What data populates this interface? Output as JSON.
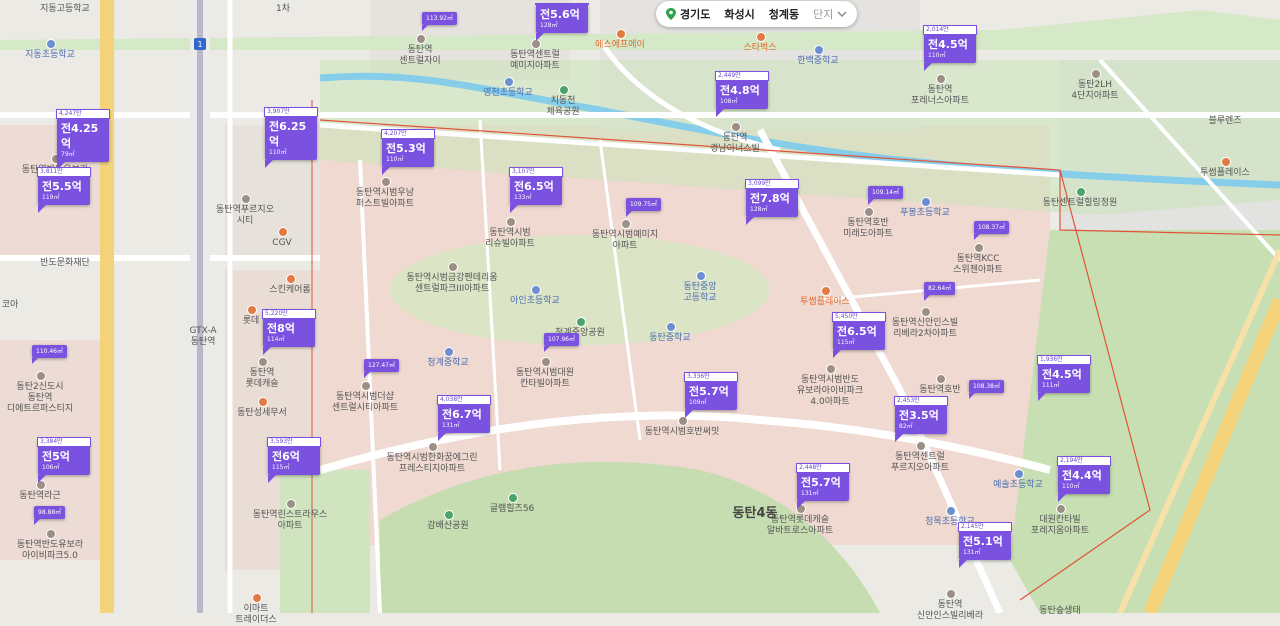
{
  "breadcrumb": {
    "province": "경기도",
    "city": "화성시",
    "dong": "청계동",
    "level": "단지",
    "icons": {
      "location": "location-pin-icon",
      "expand": "chevron-down-icon"
    }
  },
  "markers": [
    {
      "top": "",
      "price": "전5.6억",
      "area": "128㎡"
    },
    {
      "top": "2,014만",
      "price": "전4.5억",
      "area": "110㎡"
    },
    {
      "top": "2,449만",
      "price": "전4.8억",
      "area": "108㎡"
    },
    {
      "top": "4,247만",
      "price": "전4.25억",
      "area": "79㎡"
    },
    {
      "top": "3,907만",
      "price": "전6.25억",
      "area": "110㎡"
    },
    {
      "top": "4,207만",
      "price": "전5.3억",
      "area": "110㎡"
    },
    {
      "top": "3,811만",
      "price": "전5.5억",
      "area": "119㎡"
    },
    {
      "top": "3,107만",
      "price": "전6.5억",
      "area": "133㎡"
    },
    {
      "top": "3,099만",
      "price": "전7.8억",
      "area": "128㎡"
    },
    {
      "top": "5,220만",
      "price": "전8억",
      "area": "114㎡"
    },
    {
      "top": "5,450만",
      "price": "전6.5억",
      "area": "115㎡"
    },
    {
      "top": "1,936만",
      "price": "전4.5억",
      "area": "111㎡"
    },
    {
      "top": "3,336만",
      "price": "전5.7억",
      "area": "109㎡"
    },
    {
      "top": "4,038만",
      "price": "전6.7억",
      "area": "131㎡"
    },
    {
      "top": "2,453만",
      "price": "전3.5억",
      "area": "82㎡"
    },
    {
      "top": "3,384만",
      "price": "전5억",
      "area": "106㎡"
    },
    {
      "top": "3,593만",
      "price": "전6억",
      "area": "115㎡"
    },
    {
      "top": "2,448만",
      "price": "전5.7억",
      "area": "131㎡"
    },
    {
      "top": "2,194만",
      "price": "전4.4억",
      "area": "110㎡"
    },
    {
      "top": "2,145만",
      "price": "전5.1억",
      "area": "131㎡"
    }
  ],
  "area_badges": [
    "113.92㎡",
    "109.14㎡",
    "109.75㎡",
    "108.37㎡",
    "82.64㎡",
    "107.96㎡",
    "127.47㎡",
    "110.46㎡",
    "108.38㎡",
    "98.88㎡"
  ],
  "places": {
    "complexes": [
      "동탄역\n센트럴자이",
      "동탄역센트럴\n예미지아파트",
      "동탄역\n경남아너스빌",
      "동탄2LH\n4단지아파트",
      "동탄역\n포레너스아파트",
      "동탄역반도유보라\n아이비",
      "동탄역시범우남\n퍼스트빌아파트",
      "동탄역시범\n리슈빌아파트",
      "동탄역시범예미지\n아파트",
      "동탄역호반\n미래도아파트",
      "동탄역KCC\n스위첸아파트",
      "동탄역시범금강펜테리움\n센트럴파크III아파트",
      "동탄역신안인스빌\n리베라2차아파트",
      "동탄역시범반도\n유보라아이비파크\n4.0아파트",
      "동탄역시범대원\n칸타빌아파트",
      "동탄역시범더샵\n센트럴시티아파트",
      "동탄역시범한화꿈에그린\n프레스티지아파트",
      "동탄역시범호반써밋",
      "동탄역센트럴\n푸르지오아파트",
      "동탄역롯데캐슬\n알바트로스아파트",
      "대원칸타빌\n포레지움아파트",
      "동탄역\n신안인스빌리베라",
      "동탄역푸르지오\n시티",
      "동탄역\n롯데캐슬",
      "동탄역린스트라우스\n아파트",
      "동탄2신도시\n동탄역\n디에트르퍼스티지",
      "동탄역라근",
      "동탄역반도유보라\n아이비파크5.0",
      "동탄역호반"
    ],
    "schools": [
      "지동초등학교",
      "영천초등학교",
      "한백중학교",
      "푸봉초등학교",
      "아인초등학교",
      "동탄중학교",
      "동탄중앙\n고등학교",
      "청계중학교",
      "예솔초등학교",
      "청목초등학교"
    ],
    "parks": [
      "치동천\n체육공원",
      "청계중앙공원",
      "동탄센트럴힐링정원",
      "감배산공원",
      "글램힐즈56"
    ],
    "shops": [
      "스타벅스",
      "에스에프에이",
      "투썸플레이스",
      "투썸플레이스",
      "CGV",
      "스킨케어롬",
      "롯데",
      "동탄성세무서",
      "이마트\n트레이더스"
    ],
    "misc": [
      "지동고등학교",
      "반도문화재단",
      "블루렌즈",
      "동탄숲생태",
      "1차",
      "GTX-A\n동탄역",
      "코아",
      "동탄4동"
    ]
  },
  "colors": {
    "marker": "#7b52e0",
    "road": "#ffffff",
    "highway": "#f3d27a",
    "river": "#7ec8e8",
    "green": "#c8e1b8",
    "residential": "#f0d9d0",
    "boundary": "#e0533a"
  }
}
